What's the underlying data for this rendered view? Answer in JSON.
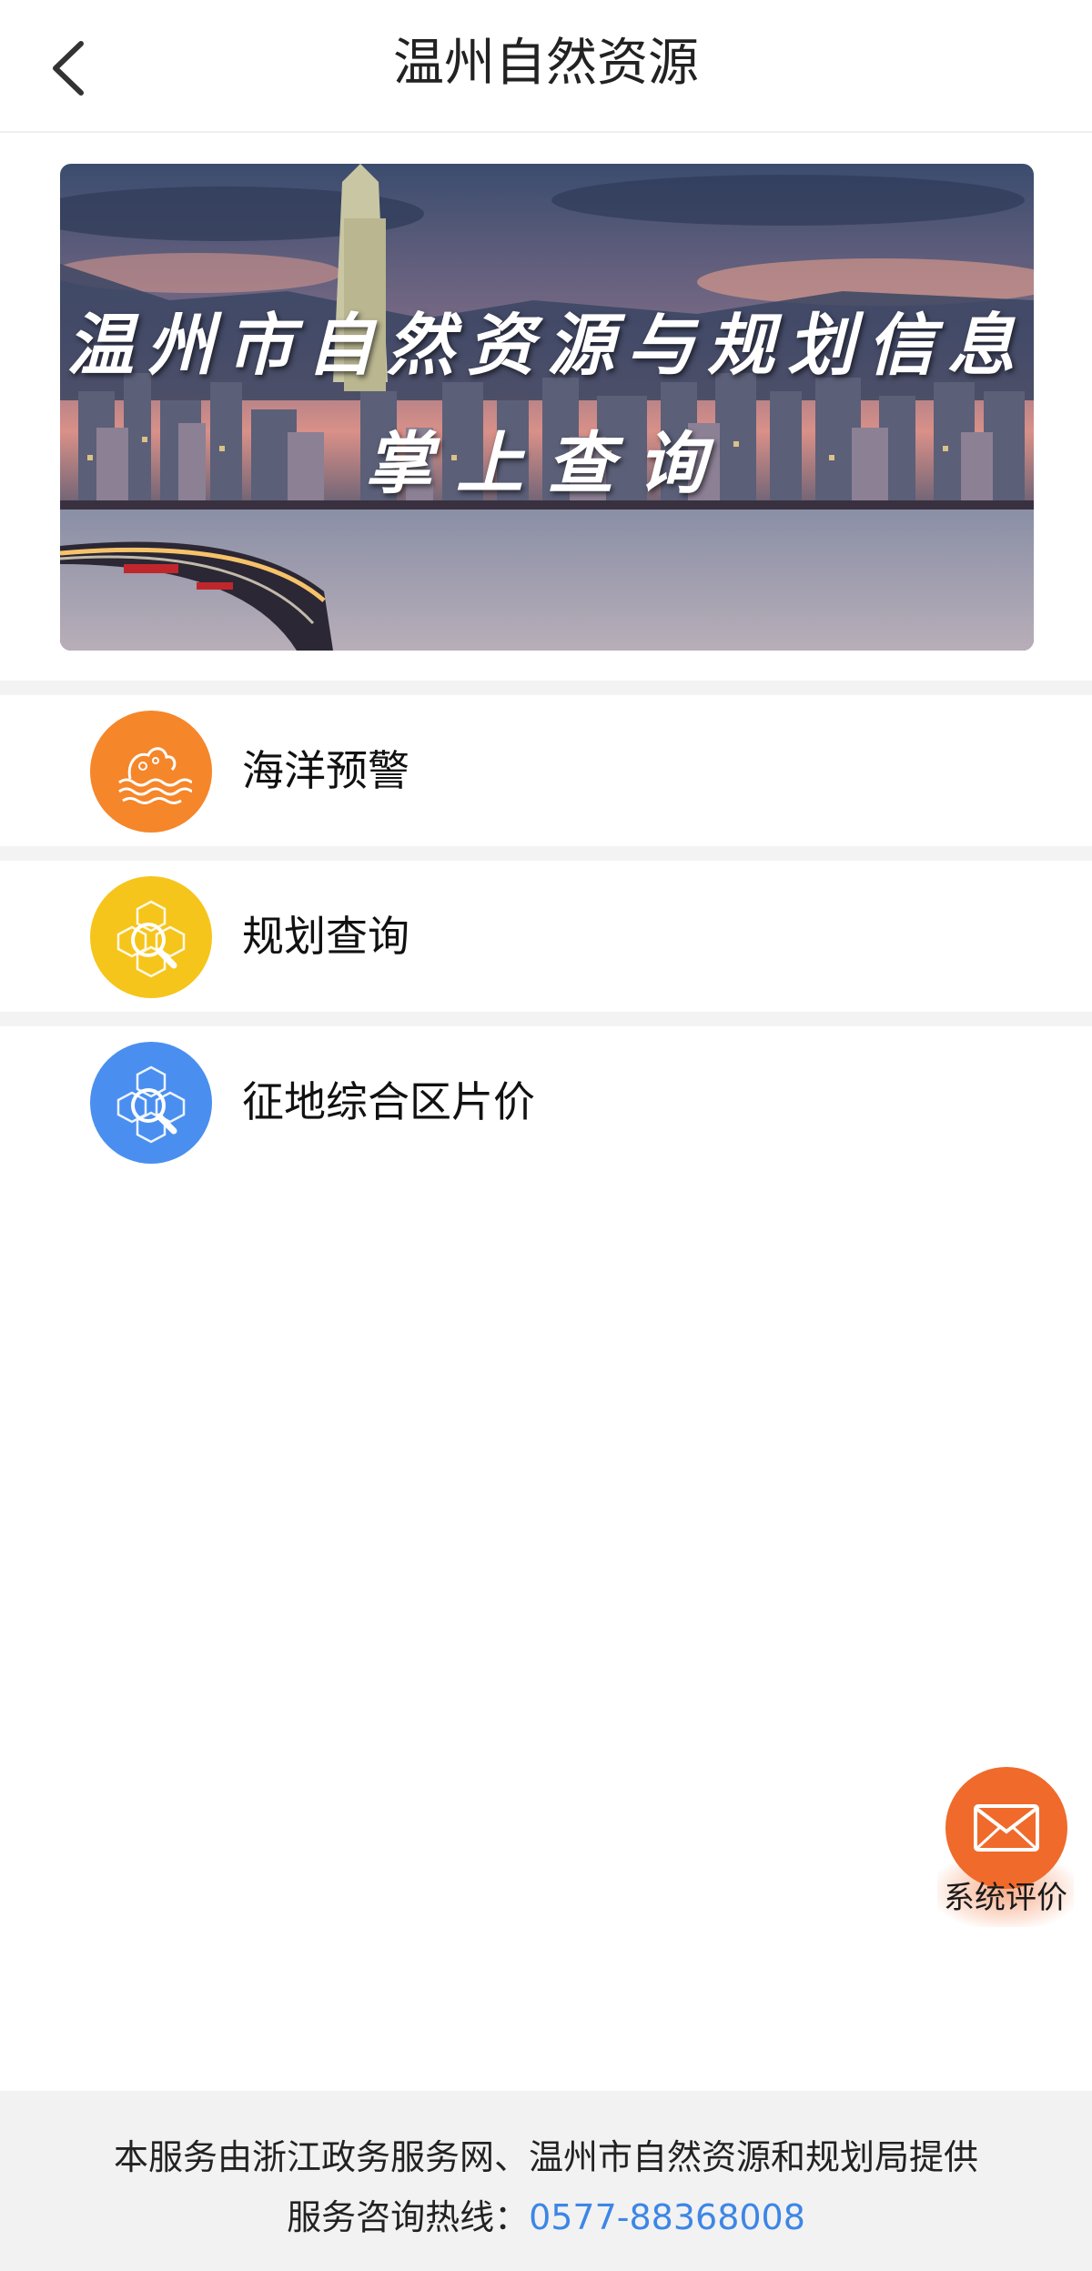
{
  "header": {
    "title": "温州自然资源"
  },
  "banner": {
    "line1": "温州市自然资源与规划信息",
    "line2": "掌上查询"
  },
  "menu": [
    {
      "label": "海洋预警",
      "icon": "ocean-wave-icon",
      "color": "#f5862a"
    },
    {
      "label": "规划查询",
      "icon": "planning-search-icon",
      "color": "#f6c51b"
    },
    {
      "label": "征地综合区片价",
      "icon": "land-price-search-icon",
      "color": "#4a8ff0"
    }
  ],
  "evaluation": {
    "label": "系统评价",
    "icon": "envelope-icon",
    "color": "#f06a2b"
  },
  "footer": {
    "line1": "本服务由浙江政务服务网、温州市自然资源和规划局提供",
    "hotline_prefix": "服务咨询热线：",
    "hotline_number": "0577-88368008",
    "hotline_color": "#3d86e6"
  }
}
